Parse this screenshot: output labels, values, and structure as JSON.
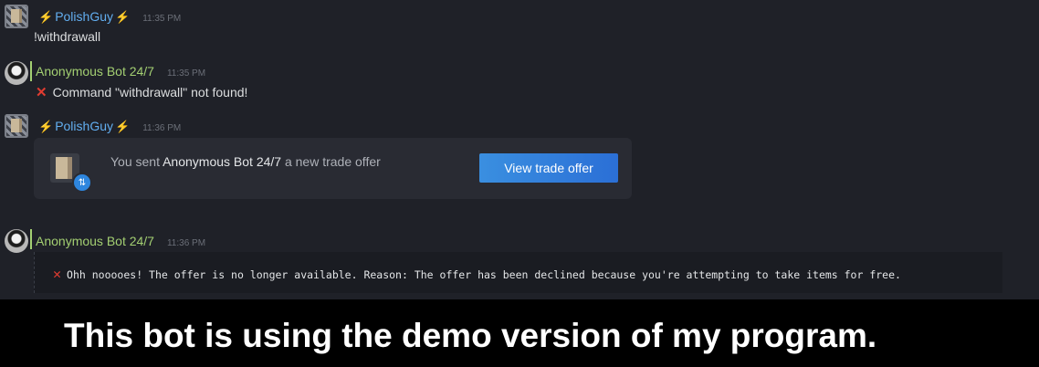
{
  "messages": [
    {
      "author": "PolishGuy",
      "bolt": "⚡",
      "time": "11:35 PM",
      "text": "!withdrawall"
    },
    {
      "author": "Anonymous Bot 24/7",
      "time": "11:35 PM",
      "error_icon": "✕",
      "text": "Command \"withdrawall\" not found!"
    },
    {
      "author": "PolishGuy",
      "bolt": "⚡",
      "time": "11:36 PM"
    },
    {
      "author": "Anonymous Bot 24/7",
      "time": "11:36 PM",
      "error_icon": "✕",
      "text": "Ohh nooooes! The offer is no longer available. Reason: The offer has been declined because you're attempting to take items for free."
    }
  ],
  "trade_card": {
    "prefix": "You sent ",
    "bot_name": "Anonymous Bot 24/7",
    "suffix": " a new trade offer",
    "button_label": "View trade offer",
    "badge_icon": "⇅"
  },
  "caption": "This bot is using the demo version of my program.",
  "colors": {
    "user_name": "#62aef0",
    "bot_name": "#a3cf72",
    "error": "#e03c31",
    "button": "#2e86de"
  },
  "icons": [
    "user-avatar-icon",
    "bot-avatar-icon",
    "lightning-bolt-icon",
    "error-x-icon",
    "trade-item-icon",
    "trade-badge-icon"
  ]
}
